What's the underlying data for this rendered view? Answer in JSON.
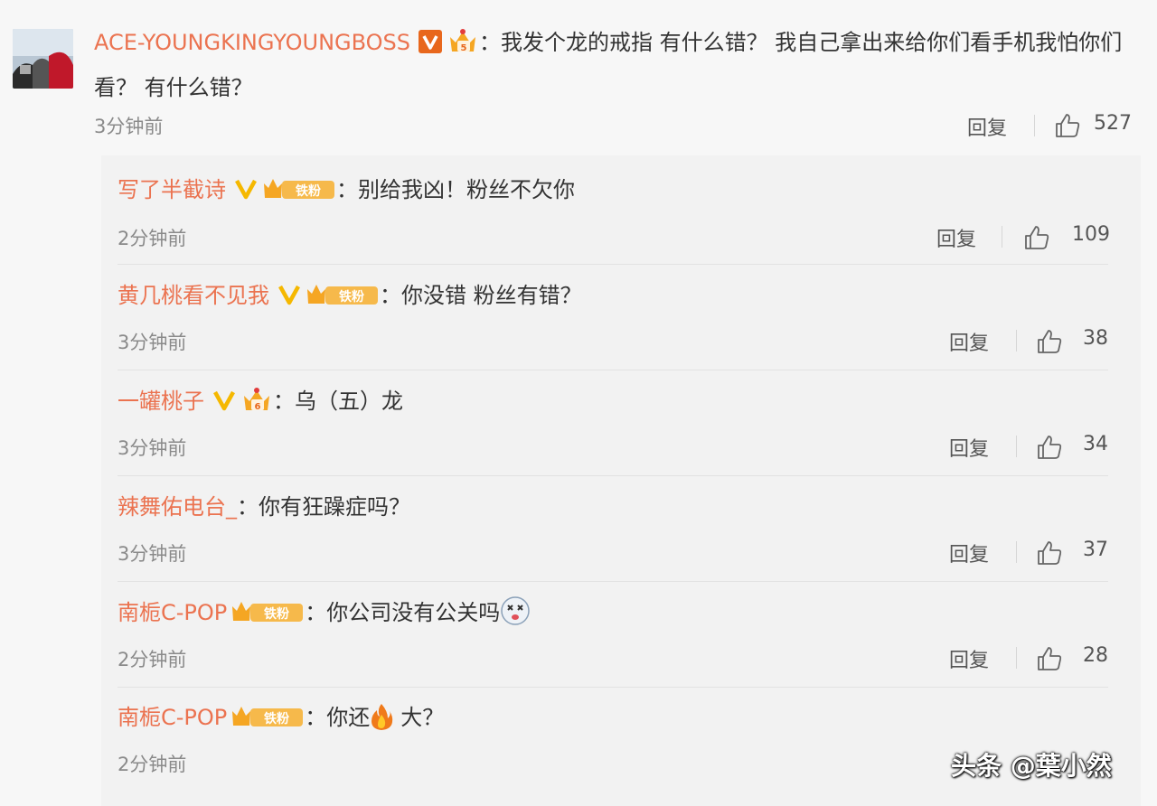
{
  "main_comment": {
    "username": "ACE-YOUNGKINGYOUNGBOSS",
    "colon": "：",
    "text": "我发个龙的戒指 有什么错？ 我自己拿出来给你们看手机我怕你们看？ 有什么错？",
    "time": "3分钟前",
    "reply_label": "回复",
    "likes": "527"
  },
  "replies": [
    {
      "username": "写了半截诗",
      "colon": "：",
      "text": "别给我凶！粉丝不欠你",
      "time": "2分钟前",
      "reply_label": "回复",
      "likes": "109",
      "fan_badge": "铁粉"
    },
    {
      "username": "黄几桃看不见我",
      "colon": "：",
      "text": "你没错 粉丝有错？",
      "time": "3分钟前",
      "reply_label": "回复",
      "likes": "38",
      "fan_badge": "铁粉"
    },
    {
      "username": "一罐桃子",
      "colon": "：",
      "text": "乌（五）龙",
      "time": "3分钟前",
      "reply_label": "回复",
      "likes": "34"
    },
    {
      "username": "辣舞佑电台_",
      "colon": "：",
      "text": "你有狂躁症吗？",
      "time": "3分钟前",
      "reply_label": "回复",
      "likes": "37"
    },
    {
      "username": "南栀C-POP",
      "colon": "：",
      "text": "你公司没有公关吗",
      "time": "2分钟前",
      "reply_label": "回复",
      "likes": "28",
      "fan_badge": "铁粉"
    },
    {
      "username": "南栀C-POP",
      "colon": "：",
      "text_before": "你还",
      "text_after": "大？",
      "time": "2分钟前",
      "fan_badge": "铁粉"
    }
  ],
  "watermark": "头条 @葉小然",
  "colors": {
    "username": "#eb7350",
    "vip_badge": "#f5a623",
    "fan_badge": "#f6b94b"
  },
  "icons": [
    "verified-v-icon",
    "crown-level-icon",
    "fan-badge-icon",
    "thumbs-up-icon",
    "dizzy-face-emoji",
    "fire-emoji"
  ]
}
